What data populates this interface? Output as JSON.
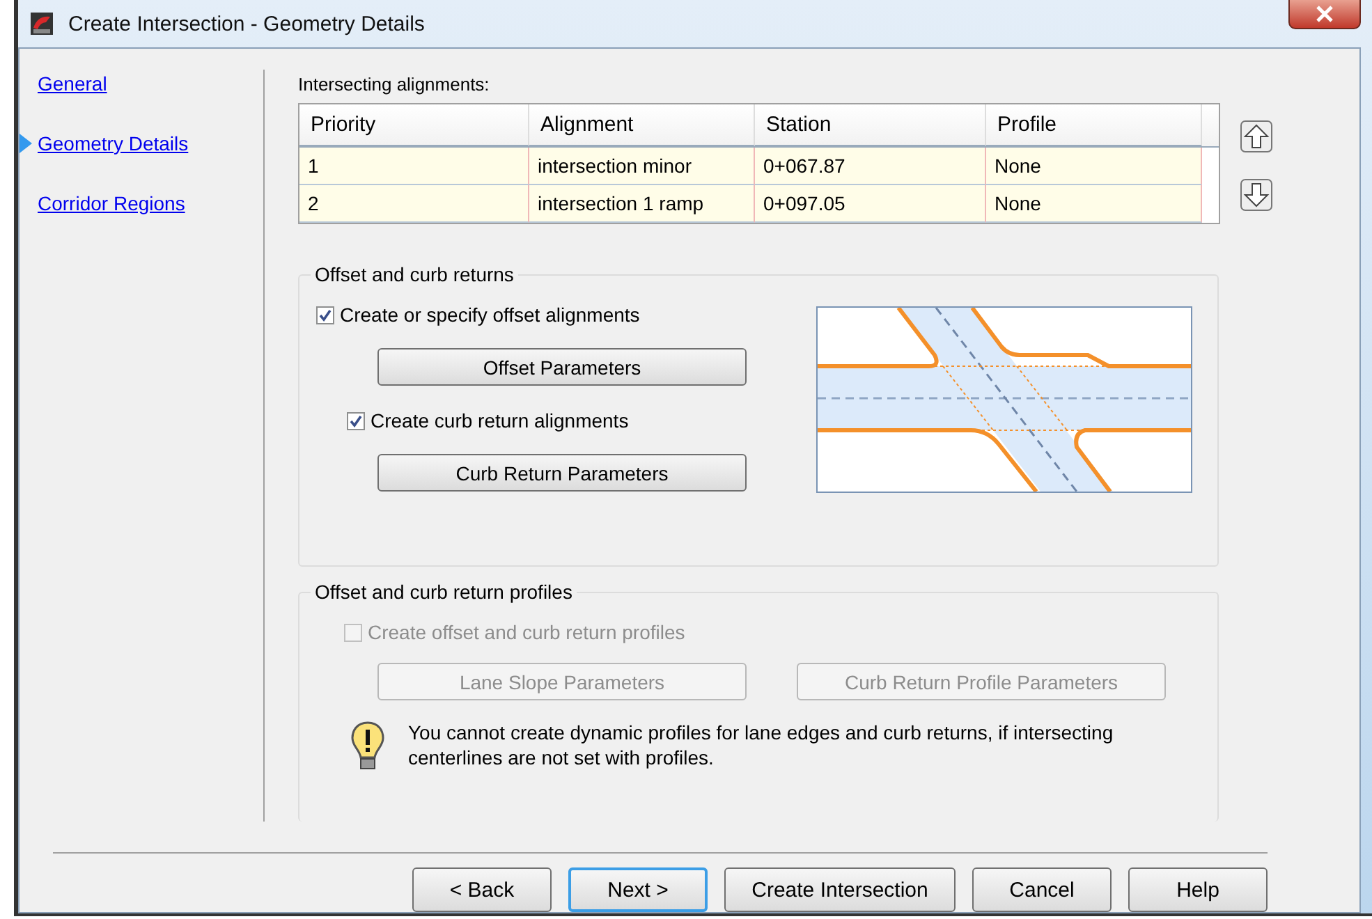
{
  "window": {
    "title": "Create Intersection - Geometry Details"
  },
  "sidebar": {
    "items": [
      {
        "label": "General",
        "selected": false
      },
      {
        "label": "Geometry Details",
        "selected": true
      },
      {
        "label": "Corridor Regions",
        "selected": false
      }
    ]
  },
  "alignments": {
    "label": "Intersecting alignments:",
    "columns": [
      "Priority",
      "Alignment",
      "Station",
      "Profile"
    ],
    "rows": [
      [
        "1",
        "intersection minor",
        "0+067.87",
        "None"
      ],
      [
        "2",
        "intersection 1 ramp",
        "0+097.05",
        "None"
      ]
    ]
  },
  "offset_group": {
    "title": "Offset and curb returns",
    "offset_alignments": {
      "label": "Create or specify offset alignments",
      "checked": true
    },
    "offset_button": {
      "label": "Offset Parameters"
    },
    "curb_alignments": {
      "label": "Create curb return alignments",
      "checked": true
    },
    "curb_button": {
      "label": "Curb Return Parameters"
    }
  },
  "profiles_group": {
    "title": "Offset and curb return profiles",
    "profiles_checkbox": {
      "label": "Create offset and curb return profiles",
      "checked": false,
      "disabled": true
    },
    "buttons": [
      {
        "label": "Lane Slope Parameters",
        "disabled": true
      },
      {
        "label": "Curb Return Profile Parameters",
        "disabled": true
      }
    ],
    "warning": "You cannot create dynamic profiles for lane edges and curb returns, if intersecting centerlines are not set with profiles."
  },
  "footer_buttons": [
    {
      "label": "< Back",
      "default": false
    },
    {
      "label": "Next >",
      "default": true
    },
    {
      "label": "Create Intersection",
      "default": false
    },
    {
      "label": "Cancel",
      "default": false
    },
    {
      "label": "Help",
      "default": false
    }
  ]
}
